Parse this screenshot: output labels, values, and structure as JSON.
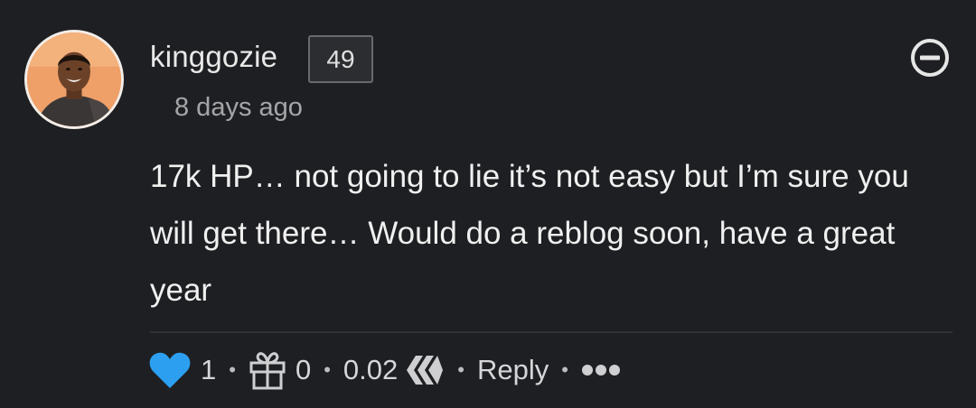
{
  "comment": {
    "author": "kinggozie",
    "reputation": "49",
    "timestamp": "8 days ago",
    "body": "17k HP… not going to lie it’s not easy but I’m sure you will get there… Would do a reblog soon, have a great year"
  },
  "footer": {
    "votes": "1",
    "gifts": "0",
    "payout": "0.02",
    "reply_label": "Reply",
    "separator": "•"
  },
  "icons": {
    "vote": "heart-icon",
    "tip": "gift-icon",
    "currency": "hive-icon",
    "more": "more-icon",
    "collapse": "minus-circle-icon"
  },
  "colors": {
    "background": "#1e1f22",
    "text": "#e8e8e8",
    "muted": "#a6a6a8",
    "heart": "#2c9ff0",
    "badge_border": "#6a6a6d"
  }
}
